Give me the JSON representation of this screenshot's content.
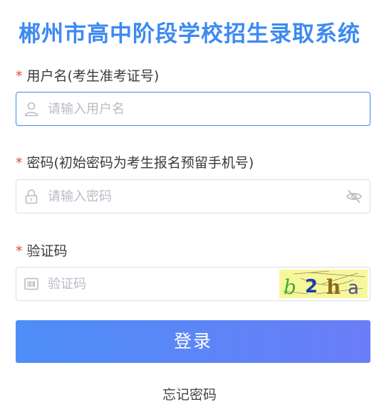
{
  "title": "郴州市高中阶段学校招生录取系统",
  "form": {
    "username": {
      "required_mark": "*",
      "label": "用户名(考生准考证号)",
      "value": "",
      "placeholder": "请输入用户名",
      "icon": "user-icon"
    },
    "password": {
      "required_mark": "*",
      "label": "密码(初始密码为考生报名预留手机号)",
      "value": "",
      "placeholder": "请输入密码",
      "icon": "lock-icon",
      "toggle_icon": "eye-off-icon"
    },
    "captcha": {
      "required_mark": "*",
      "label": "验证码",
      "value": "",
      "placeholder": "验证码",
      "icon": "barcode-icon",
      "image_text": [
        "b",
        "2",
        "h",
        "a"
      ],
      "image_text_colors": [
        "#3fae3a",
        "#1f3ca8",
        "#8a6a1a",
        "#5a4a8a"
      ]
    }
  },
  "login_button": "登录",
  "forgot_password": "忘记密码",
  "colors": {
    "title": "#3d8af0",
    "required": "#e2473d",
    "button_start": "#4d8ef6",
    "button_end": "#6a7df7",
    "focus_border": "#3d8af0"
  }
}
